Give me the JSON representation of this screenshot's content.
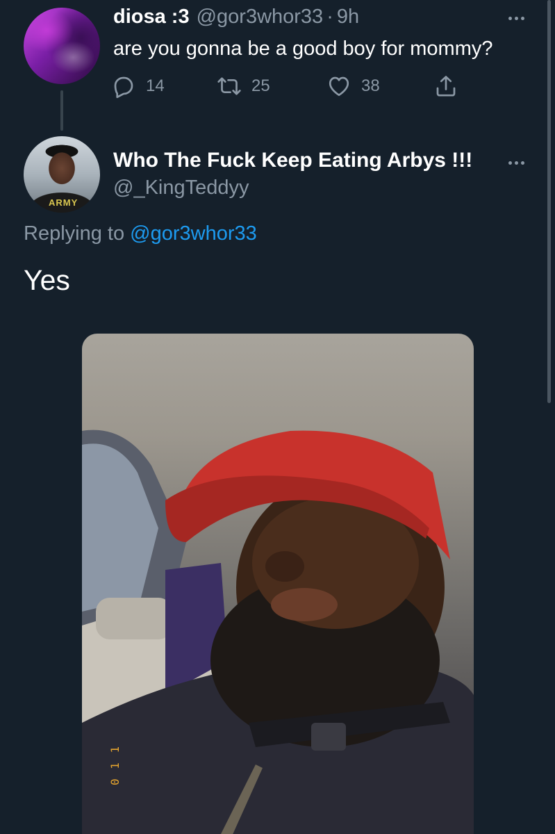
{
  "parent_tweet": {
    "display_name": "diosa :3",
    "handle": "@gor3whor33",
    "separator": "·",
    "time": "9h",
    "text": "are you gonna be a good boy for mommy?",
    "reply_count": "14",
    "retweet_count": "25",
    "like_count": "38"
  },
  "reply_tweet": {
    "display_name": "Who The Fuck Keep Eating Arbys !!!",
    "handle": "@_KingTeddyy",
    "replying_prefix": "Replying to",
    "replying_mention": "@gor3whor33",
    "text": "Yes",
    "avatar_shirt_text": "ARMY"
  },
  "photo": {
    "stamp": "0 1 1"
  },
  "colors": {
    "background": "#15202b",
    "primary_text": "#ffffff",
    "secondary_text": "#8b98a5",
    "link": "#1d9bf0",
    "thread_line": "#38444d"
  },
  "icons": {
    "reply": "reply-icon",
    "retweet": "retweet-icon",
    "like": "heart-icon",
    "share": "share-icon",
    "more": "more-dots-icon"
  }
}
